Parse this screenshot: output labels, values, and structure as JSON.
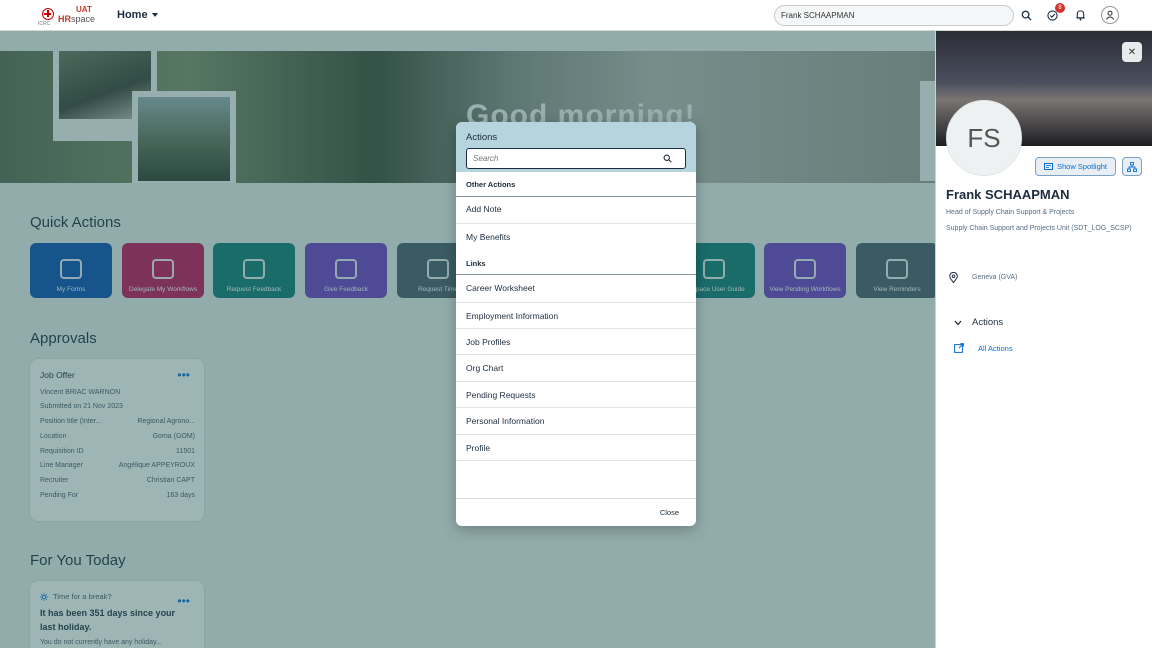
{
  "shell": {
    "logo_env": "UAT",
    "logo_hr": "HR",
    "logo_space": "space",
    "logo_org": "ICRC",
    "home_label": "Home",
    "search_value": "Frank SCHAAPMAN",
    "notifications_badge": "8"
  },
  "hero": {
    "greeting": "Good morning!"
  },
  "quick_actions": {
    "title": "Quick Actions",
    "tiles": [
      {
        "label": "My Forms",
        "color": "#0a4fb5"
      },
      {
        "label": "Delegate My Workflows",
        "color": "#c3115a"
      },
      {
        "label": "Request Feedback",
        "color": "#0f7b78"
      },
      {
        "label": "Give Feedback",
        "color": "#6e3dc7"
      },
      {
        "label": "Request Time",
        "color": "#4c5c6c"
      },
      {
        "label": "HRspace User Guide",
        "color": "#0f7b78"
      },
      {
        "label": "View Pending Workflows",
        "color": "#6e3dc7"
      },
      {
        "label": "View Reminders",
        "color": "#4c5c6c"
      }
    ]
  },
  "approvals": {
    "title": "Approvals",
    "card": {
      "title": "Job Offer",
      "candidate": "Vincent BRIAC WARNON",
      "submitted": "Submitted on 21 Nov 2023",
      "rows": [
        {
          "label": "Position title (Inter...",
          "value": "Regional Agrono..."
        },
        {
          "label": "Location",
          "value": "Goma (GOM)"
        },
        {
          "label": "Requisition ID",
          "value": "11501"
        },
        {
          "label": "Line Manager",
          "value": "Angélique APPEYROUX"
        },
        {
          "label": "Recruiter",
          "value": "Christian CAPT"
        },
        {
          "label": "Pending For",
          "value": "163 days"
        }
      ]
    }
  },
  "for_you_today": {
    "title": "For You Today",
    "card": {
      "header": "Time for a break?",
      "message": "It has been 351 days since your last holiday.",
      "sub": "You do not currently have any holiday..."
    }
  },
  "dialog": {
    "title": "Actions",
    "search_placeholder": "Search",
    "other_actions_label": "Other Actions",
    "other_actions": [
      "Add Note",
      "My Benefits"
    ],
    "links_label": "Links",
    "links": [
      "Career Worksheet",
      "Employment Information",
      "Job Profiles",
      "Org Chart",
      "Pending Requests",
      "Personal Information",
      "Profile"
    ],
    "close_label": "Close"
  },
  "side_panel": {
    "initials": "FS",
    "spotlight_label": "Show Spotlight",
    "name": "Frank SCHAAPMAN",
    "role": "Head of Supply Chain Support & Projects",
    "unit": "Supply Chain Support and Projects Unit (SDT_LOG_SCSP)",
    "location": "Geneva (GVA)",
    "actions_label": "Actions",
    "all_actions_label": "All Actions"
  }
}
